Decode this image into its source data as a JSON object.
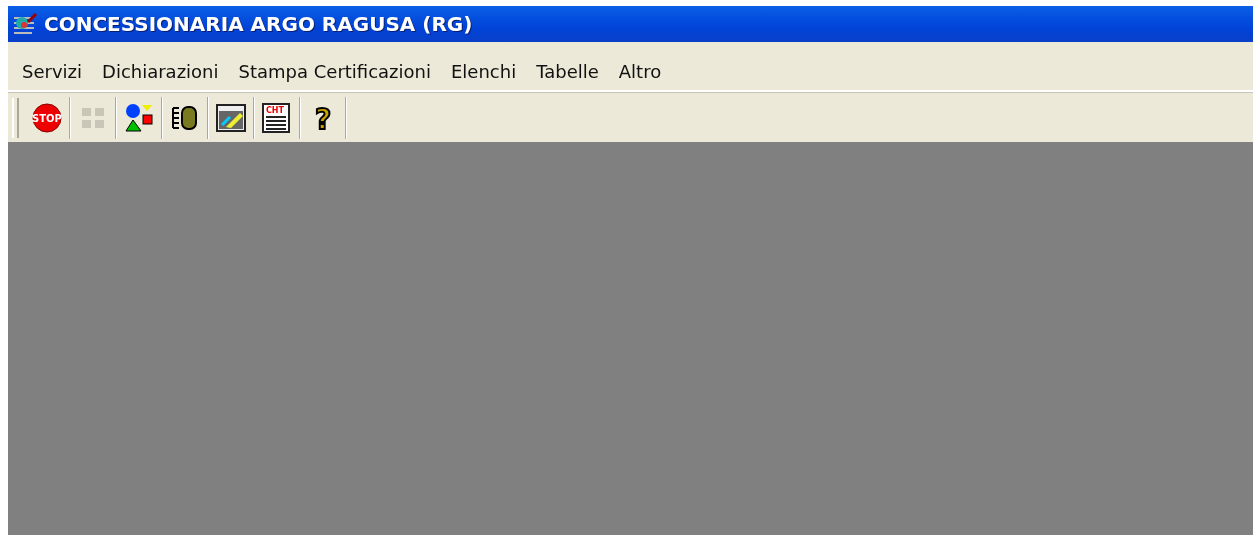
{
  "window": {
    "title": "CONCESSIONARIA ARGO RAGUSA (RG)"
  },
  "menu": [
    "Servizi",
    "Dichiarazioni",
    "Stampa Certificazioni",
    "Elenchi",
    "Tabelle",
    "Altro"
  ],
  "toolbar": [
    {
      "kind": "stop",
      "glyph": "STOP",
      "disabled": false
    },
    {
      "kind": "grid",
      "disabled": true
    },
    {
      "kind": "shapes",
      "disabled": false
    },
    {
      "kind": "cylinder",
      "disabled": false
    },
    {
      "kind": "picture",
      "disabled": false
    },
    {
      "kind": "printer",
      "glyph": "CHT",
      "disabled": false
    },
    {
      "kind": "help",
      "glyph": "?",
      "disabled": false
    }
  ]
}
